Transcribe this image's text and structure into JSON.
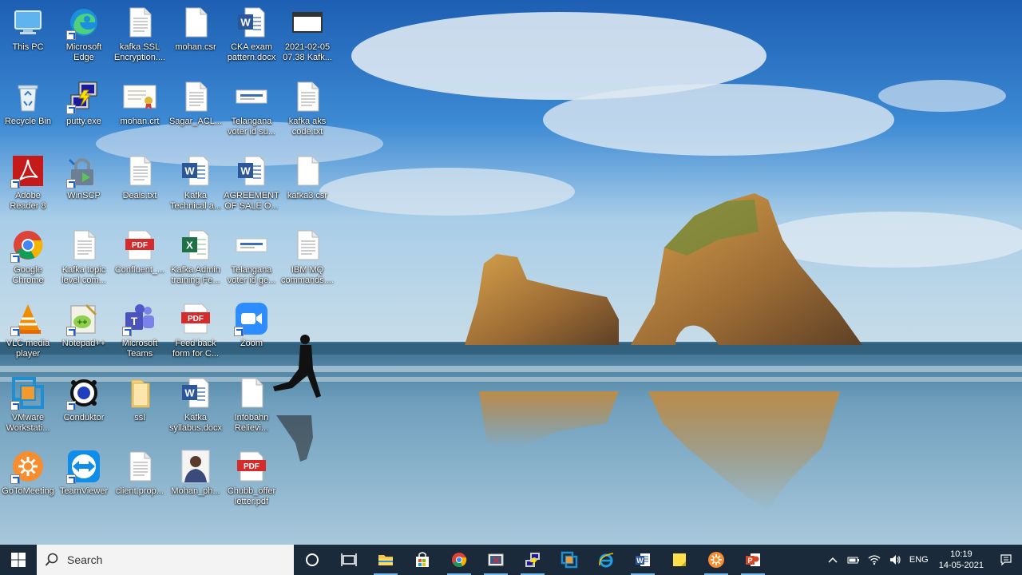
{
  "desktop": {
    "icons": [
      {
        "label": "This PC",
        "icon": "this-pc-icon",
        "shortcut": false
      },
      {
        "label": "Microsoft Edge",
        "icon": "edge-icon",
        "shortcut": true
      },
      {
        "label": "kafka SSL Encryption....",
        "icon": "text-file-icon",
        "shortcut": false
      },
      {
        "label": "mohan.csr",
        "icon": "blank-file-icon",
        "shortcut": false
      },
      {
        "label": "CKA exam pattern.docx",
        "icon": "word-doc-icon",
        "shortcut": false
      },
      {
        "label": "2021-02-05 07.38 Kafk...",
        "icon": "video-file-icon",
        "shortcut": false
      },
      {
        "label": "Recycle Bin",
        "icon": "recycle-bin-icon",
        "shortcut": false
      },
      {
        "label": "putty.exe",
        "icon": "putty-icon",
        "shortcut": true
      },
      {
        "label": "mohan.crt",
        "icon": "certificate-icon",
        "shortcut": false
      },
      {
        "label": "Sagar_ACL...",
        "icon": "text-file-icon",
        "shortcut": false
      },
      {
        "label": "Telangana voter id su...",
        "icon": "image-file-icon",
        "shortcut": false
      },
      {
        "label": "kafka aks code.txt",
        "icon": "text-file-icon",
        "shortcut": false
      },
      {
        "label": "Adobe Reader 8",
        "icon": "adobe-reader-icon",
        "shortcut": true
      },
      {
        "label": "WinSCP",
        "icon": "winscp-icon",
        "shortcut": true
      },
      {
        "label": "Deals.txt",
        "icon": "text-file-icon",
        "shortcut": false
      },
      {
        "label": "Kafka Technical a...",
        "icon": "word-doc-icon",
        "shortcut": false
      },
      {
        "label": "AGREEMENT OF SALE O...",
        "icon": "word-doc-icon",
        "shortcut": false
      },
      {
        "label": "kafka3.csr",
        "icon": "blank-file-icon",
        "shortcut": false
      },
      {
        "label": "Google Chrome",
        "icon": "chrome-icon",
        "shortcut": true
      },
      {
        "label": "Kafka topic level com...",
        "icon": "text-file-icon",
        "shortcut": false
      },
      {
        "label": "Confluent_...",
        "icon": "pdf-icon",
        "shortcut": false
      },
      {
        "label": "Kafka Admin training Fe...",
        "icon": "excel-icon",
        "shortcut": false
      },
      {
        "label": "Telangana voter id ge...",
        "icon": "image-file-icon",
        "shortcut": false
      },
      {
        "label": "IBM MQ commands....",
        "icon": "text-file-icon",
        "shortcut": false
      },
      {
        "label": "VLC media player",
        "icon": "vlc-icon",
        "shortcut": true
      },
      {
        "label": "Notepad++",
        "icon": "notepadpp-icon",
        "shortcut": true
      },
      {
        "label": "Microsoft Teams",
        "icon": "teams-icon",
        "shortcut": true
      },
      {
        "label": "Feed back form for C...",
        "icon": "pdf-icon",
        "shortcut": false
      },
      {
        "label": "Zoom",
        "icon": "zoom-icon",
        "shortcut": true
      },
      {
        "label": "VMware Workstati...",
        "icon": "vmware-icon",
        "shortcut": true
      },
      {
        "label": "Conduktor",
        "icon": "conduktor-icon",
        "shortcut": true
      },
      {
        "label": "ssl",
        "icon": "folder-icon",
        "shortcut": false
      },
      {
        "label": "Kafka syllabus.docx",
        "icon": "word-doc-icon",
        "shortcut": false
      },
      {
        "label": "Infobahn Relievi...",
        "icon": "blank-file-icon",
        "shortcut": false
      },
      {
        "label": "GoToMeeting",
        "icon": "gotomeeting-icon",
        "shortcut": true
      },
      {
        "label": "TeamViewer",
        "icon": "teamviewer-icon",
        "shortcut": true
      },
      {
        "label": "client.prop...",
        "icon": "text-file-icon",
        "shortcut": false
      },
      {
        "label": "Mohan_ph...",
        "icon": "photo-icon",
        "shortcut": false
      },
      {
        "label": "Chubb_offer letter.pdf",
        "icon": "pdf-icon",
        "shortcut": false
      }
    ]
  },
  "taskbar": {
    "search_placeholder": "Search",
    "apps": [
      {
        "icon": "file-explorer-icon",
        "active": true
      },
      {
        "icon": "store-icon",
        "active": false
      },
      {
        "icon": "chrome-icon",
        "active": true
      },
      {
        "icon": "snipping-tool-icon",
        "active": true
      },
      {
        "icon": "putty-icon",
        "active": true
      },
      {
        "icon": "vmware-icon",
        "active": false
      },
      {
        "icon": "internet-explorer-icon",
        "active": false
      },
      {
        "icon": "word-icon",
        "active": true
      },
      {
        "icon": "sticky-notes-icon",
        "active": false
      },
      {
        "icon": "gotomeeting-icon",
        "active": true
      },
      {
        "icon": "powerpoint-icon",
        "active": true
      }
    ],
    "tray": {
      "language": "ENG",
      "time": "10:19",
      "date": "14-05-2021"
    }
  },
  "colors": {
    "taskbar": "#1b2a3a",
    "active_indicator": "#76b9ed"
  }
}
